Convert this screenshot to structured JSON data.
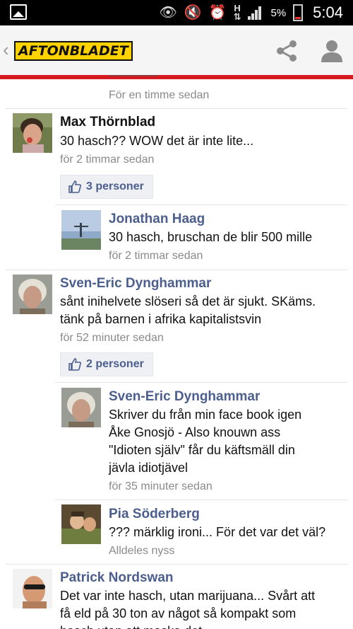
{
  "status_bar": {
    "battery": "5%",
    "time": "5:04",
    "h_label": "H"
  },
  "header": {
    "logo": "AFTONBLADET"
  },
  "partial_top": {
    "time": "För en timme sedan"
  },
  "comments": [
    {
      "name": "Max Thörnblad",
      "text": "30 hasch?? WOW det är inte lite...",
      "time": "för 2 timmar sedan",
      "likes": "3 personer",
      "replies": [
        {
          "name": "Jonathan Haag",
          "text": "30 hasch, bruschan de blir 500 mille",
          "time": "för 2 timmar sedan"
        }
      ]
    },
    {
      "name": "Sven-Eric Dynghammar",
      "text_lines": [
        "sånt inihelvete slöseri så det är sjukt. SKäms.",
        "tänk på barnen i afrika kapitalistsvin"
      ],
      "time": "för 52 minuter sedan",
      "likes": "2 personer",
      "replies": [
        {
          "name": "Sven-Eric Dynghammar",
          "text_lines": [
            "Skriver du från min face book igen",
            "Åke Gnosjö - Also knouwn ass",
            "\"Idioten själv\" får du käftsmäll din",
            "jävla idiotjävel"
          ],
          "time": "för 35 minuter sedan"
        },
        {
          "name": "Pia Söderberg",
          "text": "??? märklig ironi... För det var det väl?",
          "time": "Alldeles nyss"
        }
      ]
    },
    {
      "name": "Patrick Nordswan",
      "text_lines": [
        "Det var inte hasch, utan marijuana... Svårt att",
        "få eld på 30 ton av något så kompakt som",
        "hasch utan att maska det."
      ]
    }
  ],
  "colors": {
    "accent_red": "#d71920",
    "name_blue": "#4b5e8e",
    "logo_yellow": "#ffd200"
  }
}
